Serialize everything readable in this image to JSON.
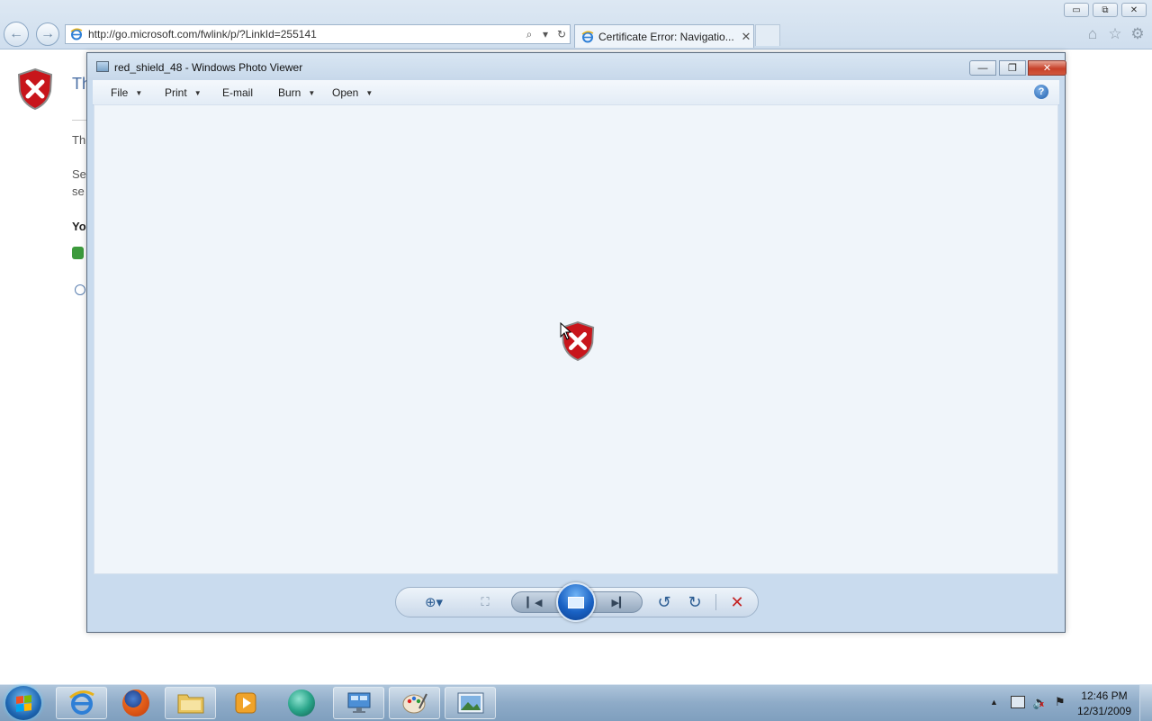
{
  "browser": {
    "address_url": "http://go.microsoft.com/fwlink/p/?LinkId=255141",
    "tab_title": "Certificate Error: Navigatio...",
    "tab_close": "✕",
    "min_label": "▭",
    "max_label": "⧉",
    "close_label": "✕",
    "back_glyph": "←",
    "forward_glyph": "→",
    "search_glyph": "⌕",
    "refresh_glyph": "↻",
    "home_glyph": "⌂",
    "favorites_glyph": "☆",
    "tools_glyph": "⚙"
  },
  "background_page": {
    "heading_fragment": "Th",
    "line1_fragment": "Th",
    "line2a_fragment": "Se",
    "line2b_fragment": "se",
    "bold_fragment": "Yo"
  },
  "photo_viewer": {
    "title": "red_shield_48 - Windows Photo Viewer",
    "min_label": "—",
    "max_label": "❐",
    "close_label": "✕",
    "menu": [
      {
        "label": "File",
        "has_dropdown": true
      },
      {
        "label": "Print",
        "has_dropdown": true
      },
      {
        "label": "E-mail",
        "has_dropdown": false
      },
      {
        "label": "Burn",
        "has_dropdown": true
      },
      {
        "label": "Open",
        "has_dropdown": true
      }
    ],
    "menu_caret": "▼",
    "help_label": "?",
    "controls": {
      "zoom_glyph": "⊕▾",
      "fit_glyph": "⛶",
      "prev_glyph": "▎◀",
      "next_glyph": "▶▎",
      "rotate_left_glyph": "↺",
      "rotate_right_glyph": "↻",
      "delete_glyph": "✕"
    }
  },
  "taskbar": {
    "tray_up_glyph": "▲",
    "volume_glyph": "🔈",
    "volume_muted_glyph": "x",
    "action_center_glyph": "⚑",
    "clock_time": "12:46 PM",
    "clock_date": "12/31/2009"
  },
  "colors": {
    "error_red": "#c8151b",
    "shield_border": "#8a8a8a",
    "accent_blue": "#1a62c4"
  }
}
